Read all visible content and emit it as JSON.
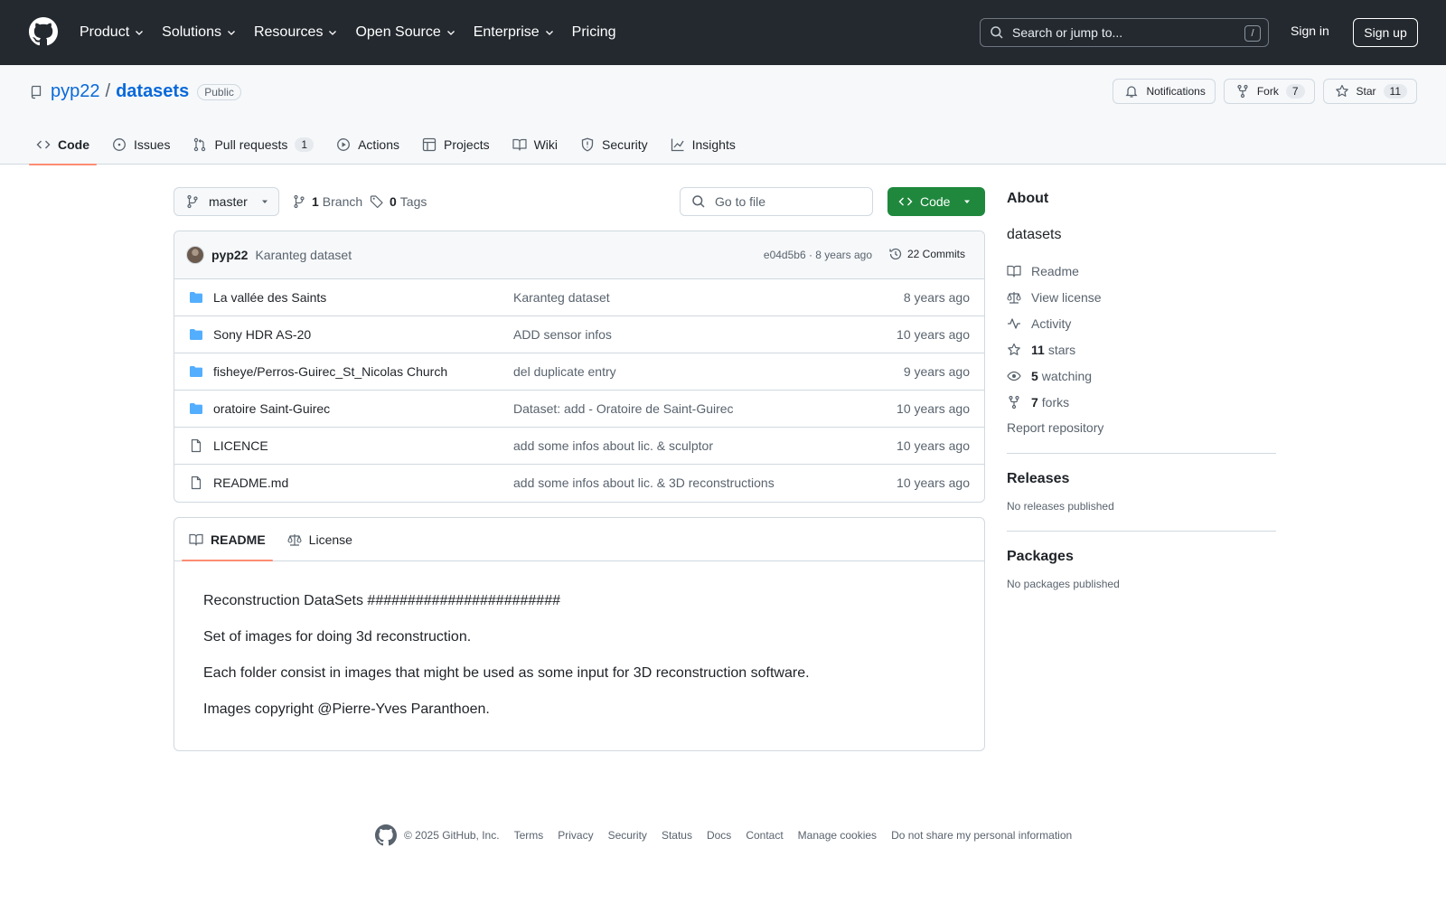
{
  "header": {
    "nav": [
      {
        "label": "Product",
        "chevron": true
      },
      {
        "label": "Solutions",
        "chevron": true
      },
      {
        "label": "Resources",
        "chevron": true
      },
      {
        "label": "Open Source",
        "chevron": true
      },
      {
        "label": "Enterprise",
        "chevron": true
      },
      {
        "label": "Pricing",
        "chevron": false
      }
    ],
    "search_placeholder": "Search or jump to...",
    "search_shortcut": "/",
    "sign_in": "Sign in",
    "sign_up": "Sign up"
  },
  "repo": {
    "owner": "pyp22",
    "separator": "/",
    "name": "datasets",
    "visibility": "Public",
    "notifications_label": "Notifications",
    "fork_label": "Fork",
    "fork_count": "7",
    "star_label": "Star",
    "star_count": "11",
    "tabs": [
      {
        "label": "Code",
        "icon": "code-icon",
        "active": true
      },
      {
        "label": "Issues",
        "icon": "issue-icon"
      },
      {
        "label": "Pull requests",
        "icon": "pull-request-icon",
        "count": "1"
      },
      {
        "label": "Actions",
        "icon": "play-icon"
      },
      {
        "label": "Projects",
        "icon": "table-icon"
      },
      {
        "label": "Wiki",
        "icon": "book-icon"
      },
      {
        "label": "Security",
        "icon": "shield-icon"
      },
      {
        "label": "Insights",
        "icon": "graph-icon"
      }
    ]
  },
  "toolbar": {
    "branch": "master",
    "branch_count": "1",
    "branch_label": "Branch",
    "tag_count": "0",
    "tag_label": "Tags",
    "goto_file": "Go to file",
    "code_button": "Code"
  },
  "commit": {
    "author": "pyp22",
    "message": "Karanteg dataset",
    "meta": "e04d5b6 · 8 years ago",
    "commits_label": "22 Commits"
  },
  "files": [
    {
      "name": "La vallée des Saints",
      "type": "folder",
      "message": "Karanteg dataset",
      "age": "8 years ago"
    },
    {
      "name": "Sony HDR AS-20",
      "type": "folder",
      "message": "ADD sensor infos",
      "age": "10 years ago"
    },
    {
      "name": "fisheye/Perros-Guirec_St_Nicolas Church",
      "type": "folder",
      "message": "del duplicate entry",
      "age": "9 years ago"
    },
    {
      "name": "oratoire Saint-Guirec",
      "type": "folder",
      "message": "Dataset: add - Oratoire de Saint-Guirec",
      "age": "10 years ago"
    },
    {
      "name": "LICENCE",
      "type": "file",
      "message": "add some infos about lic. & sculptor",
      "age": "10 years ago"
    },
    {
      "name": "README.md",
      "type": "file",
      "message": "add some infos about lic. & 3D reconstructions",
      "age": "10 years ago"
    }
  ],
  "readme": {
    "tabs": [
      {
        "label": "README",
        "active": true
      },
      {
        "label": "License"
      }
    ],
    "paragraphs": [
      "Reconstruction DataSets ########################",
      "Set of images for doing 3d reconstruction.",
      "Each folder consist in images that might be used as some input for 3D reconstruction software.",
      "Images copyright @Pierre-Yves Paranthoen."
    ]
  },
  "about": {
    "title": "About",
    "description": "datasets",
    "readme": "Readme",
    "license": "View license",
    "activity": "Activity",
    "stars_count": "11",
    "stars_label": "stars",
    "watching_count": "5",
    "watching_label": "watching",
    "forks_count": "7",
    "forks_label": "forks",
    "report": "Report repository"
  },
  "releases": {
    "title": "Releases",
    "empty": "No releases published"
  },
  "packages": {
    "title": "Packages",
    "empty": "No packages published"
  },
  "footer": {
    "copyright": "© 2025 GitHub, Inc.",
    "links": [
      "Terms",
      "Privacy",
      "Security",
      "Status",
      "Docs",
      "Contact",
      "Manage cookies",
      "Do not share my personal information"
    ]
  },
  "colors": {
    "header_bg": "#24292f",
    "link": "#0969da",
    "primary_button": "#1f883d",
    "active_tab_underline": "#fd8c73",
    "folder_icon": "#54aeff"
  }
}
